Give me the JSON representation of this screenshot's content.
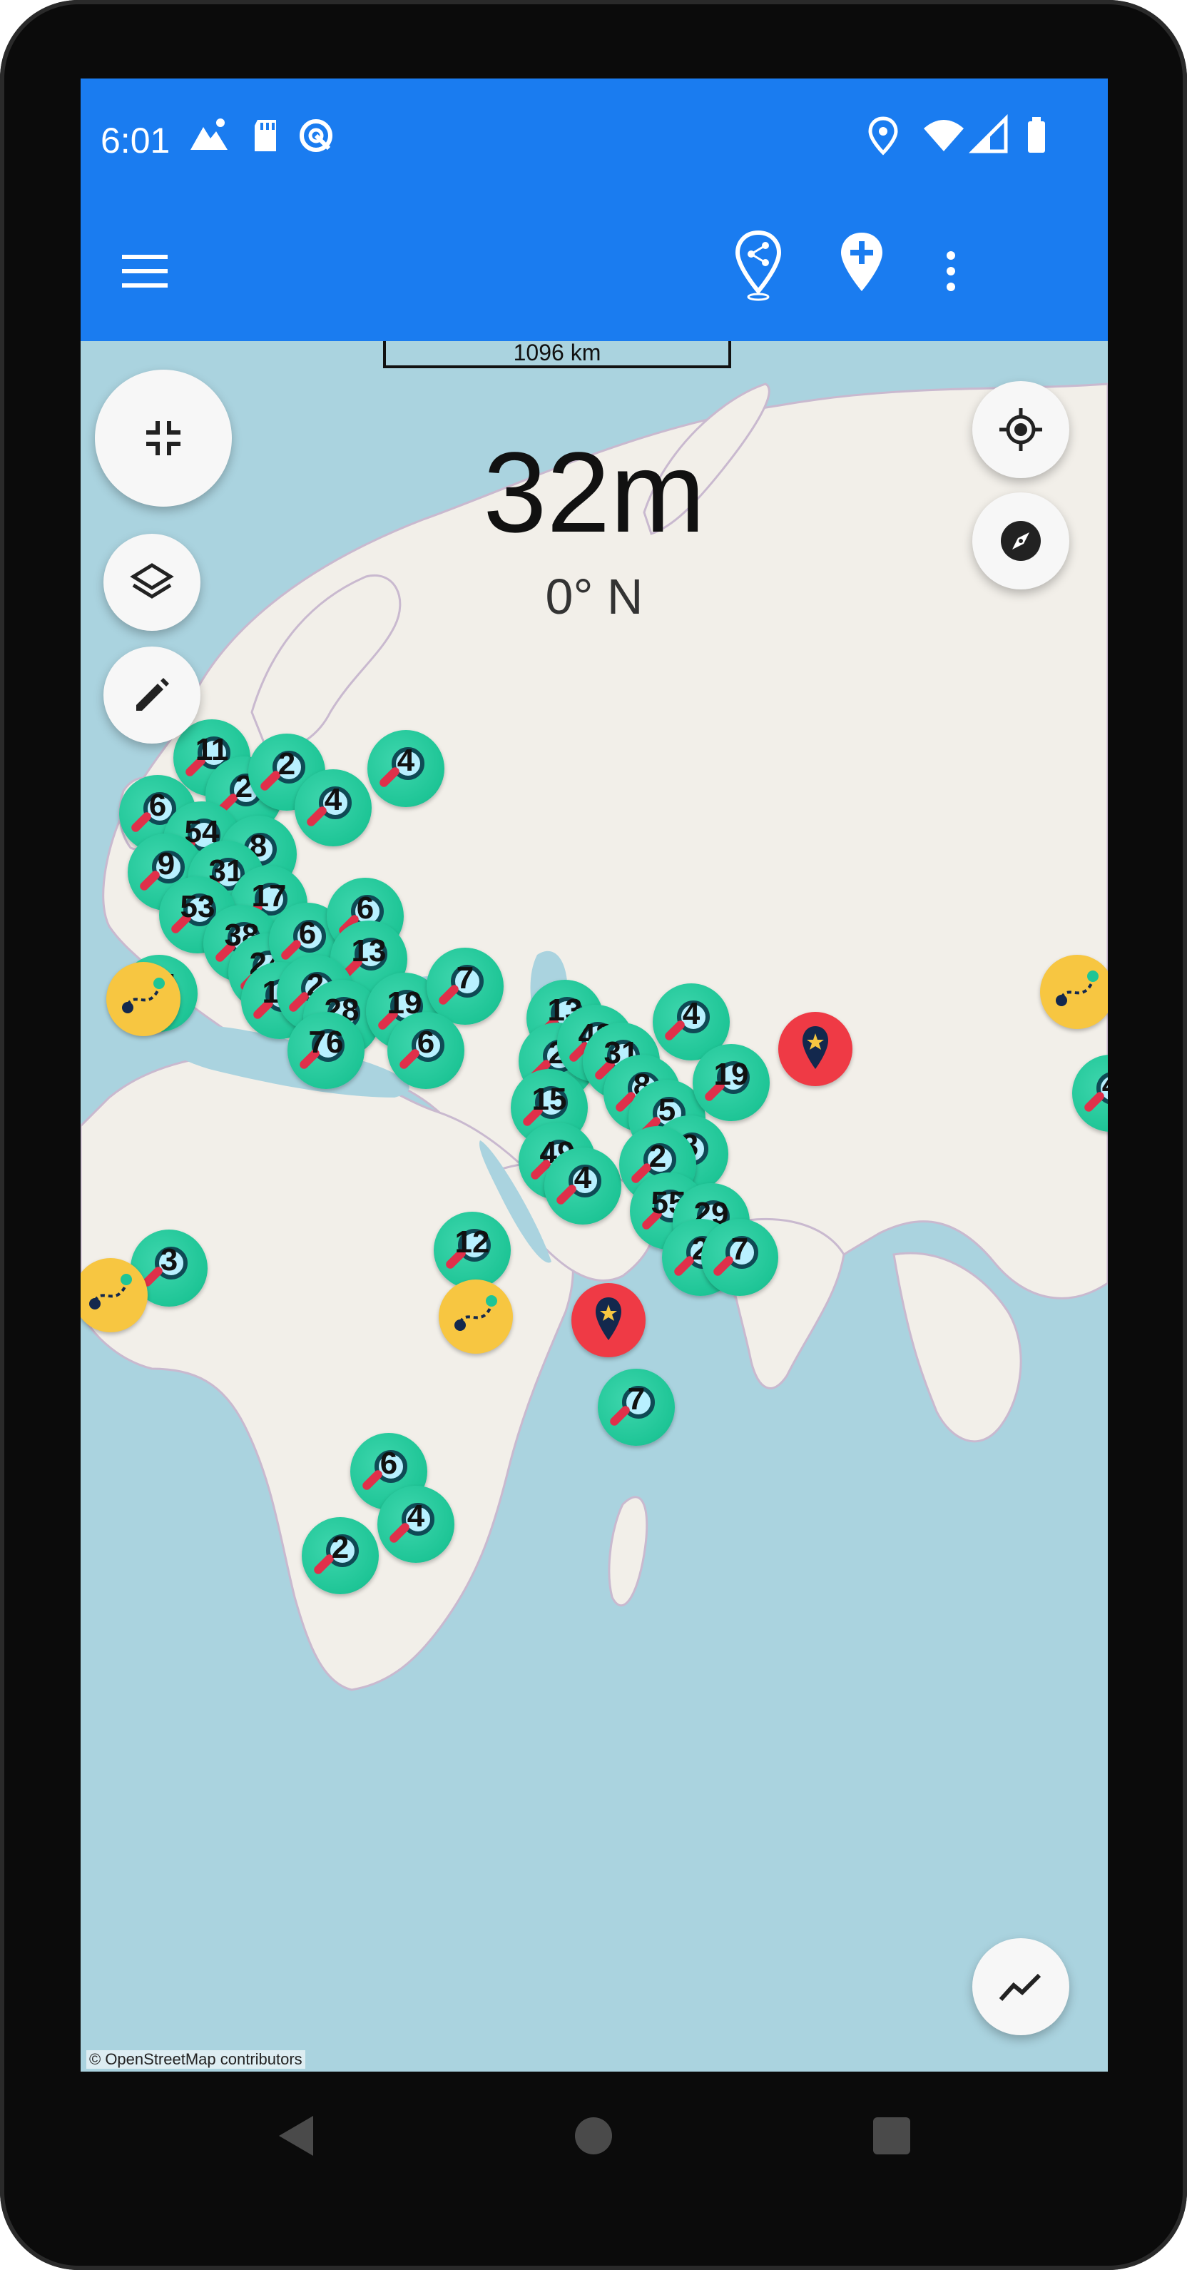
{
  "status_bar": {
    "time": "6:01",
    "left_icons": [
      "mountain-icon",
      "sd-card-icon",
      "sync-icon"
    ],
    "right_icons": [
      "location-icon",
      "wifi-icon",
      "signal-icon",
      "battery-icon"
    ]
  },
  "app_bar": {
    "menu_icon": "menu-icon",
    "share_location_icon": "share-location-icon",
    "add_pin_icon": "add-pin-icon",
    "more_icon": "more-vert-icon"
  },
  "map": {
    "scale_label": "1096 km",
    "altitude": "32m",
    "heading": "0° N",
    "attribution": "© OpenStreetMap contributors",
    "clusters": [
      {
        "count": "11"
      },
      {
        "count": "2"
      },
      {
        "count": "2"
      },
      {
        "count": "4"
      },
      {
        "count": "4"
      },
      {
        "count": "6"
      },
      {
        "count": "54"
      },
      {
        "count": "8"
      },
      {
        "count": "9"
      },
      {
        "count": "31"
      },
      {
        "count": "17"
      },
      {
        "count": "53"
      },
      {
        "count": "38"
      },
      {
        "count": "24"
      },
      {
        "count": "6"
      },
      {
        "count": "6"
      },
      {
        "count": "13"
      },
      {
        "count": "24"
      },
      {
        "count": "13"
      },
      {
        "count": "2"
      },
      {
        "count": "28"
      },
      {
        "count": "76"
      },
      {
        "count": "19"
      },
      {
        "count": "7"
      },
      {
        "count": "6"
      },
      {
        "count": "13"
      },
      {
        "count": "2"
      },
      {
        "count": "48"
      },
      {
        "count": "31"
      },
      {
        "count": "4"
      },
      {
        "count": "15"
      },
      {
        "count": "8"
      },
      {
        "count": "5"
      },
      {
        "count": "19"
      },
      {
        "count": "49"
      },
      {
        "count": "4"
      },
      {
        "count": "3"
      },
      {
        "count": "2"
      },
      {
        "count": "55"
      },
      {
        "count": "29"
      },
      {
        "count": "2"
      },
      {
        "count": "7"
      },
      {
        "count": "4"
      },
      {
        "count": "3"
      },
      {
        "count": "12"
      },
      {
        "count": "7"
      },
      {
        "count": "6"
      },
      {
        "count": "4"
      },
      {
        "count": "2"
      }
    ]
  },
  "controls": {
    "collapse_icon": "collapse-icon",
    "layers_icon": "layers-icon",
    "edit_icon": "edit-icon",
    "my_location_icon": "my-location-icon",
    "compass_icon": "compass-icon",
    "chart_icon": "chart-icon"
  },
  "colors": {
    "primary": "#1a7cf0",
    "cluster": "#1ec596",
    "pin_red": "#ef3a45",
    "pin_yellow": "#f7c641",
    "sea": "#aad3df",
    "land": "#f2efe9"
  }
}
